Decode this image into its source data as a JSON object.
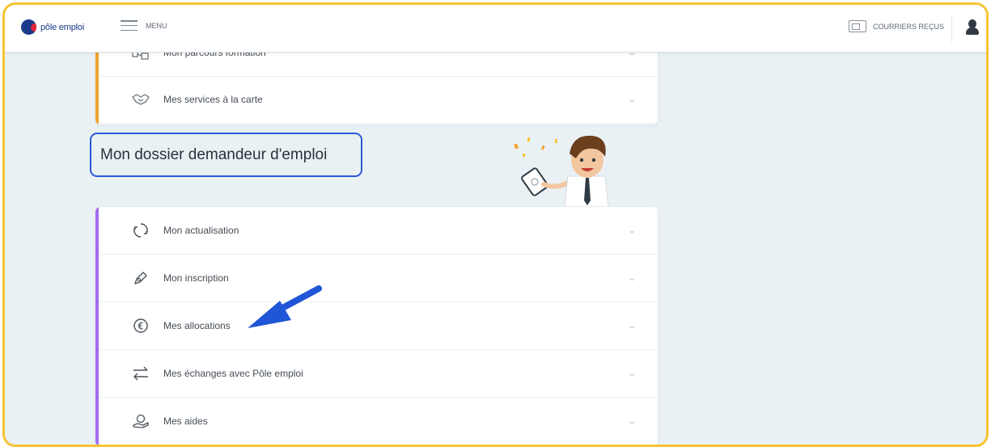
{
  "header": {
    "logo_text": "pôle emploi",
    "menu_label": "MENU",
    "mail_label": "COURRIERS REÇUS"
  },
  "top_card": {
    "items": [
      {
        "label": "Mon parcours formation",
        "icon": "training-path-icon"
      },
      {
        "label": "Mes services à la carte",
        "icon": "handshake-icon"
      }
    ]
  },
  "section_title": "Mon dossier demandeur d'emploi",
  "main_card": {
    "items": [
      {
        "label": "Mon actualisation",
        "icon": "refresh-icon"
      },
      {
        "label": "Mon inscription",
        "icon": "pen-icon"
      },
      {
        "label": "Mes allocations",
        "icon": "euro-icon"
      },
      {
        "label": "Mes échanges avec Pôle emploi",
        "icon": "exchange-arrows-icon"
      },
      {
        "label": "Mes aides",
        "icon": "hand-coin-icon"
      }
    ]
  },
  "colors": {
    "frame_border": "#f6c432",
    "top_card_accent": "#f0a530",
    "main_card_accent": "#a26cf2",
    "title_border": "#2b5ad5",
    "annotation_arrow": "#1e56d6"
  }
}
